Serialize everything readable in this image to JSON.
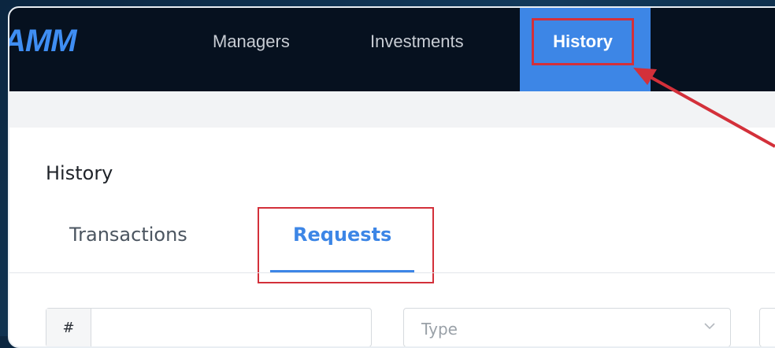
{
  "app": {
    "logo_text": "AMM"
  },
  "nav": {
    "items": [
      {
        "label": "Managers"
      },
      {
        "label": "Investments"
      },
      {
        "label": "History"
      }
    ]
  },
  "page": {
    "title": "History"
  },
  "tabs": [
    {
      "label": "Transactions",
      "active": false
    },
    {
      "label": "Requests",
      "active": true
    }
  ],
  "filters": {
    "number_prefix": "#",
    "type_placeholder": "Type"
  },
  "colors": {
    "accent": "#3d86e6",
    "annotation": "#d3303a",
    "topbar": "#06111f"
  },
  "icons": [
    "chevron-down-icon",
    "arrow-annotation"
  ]
}
